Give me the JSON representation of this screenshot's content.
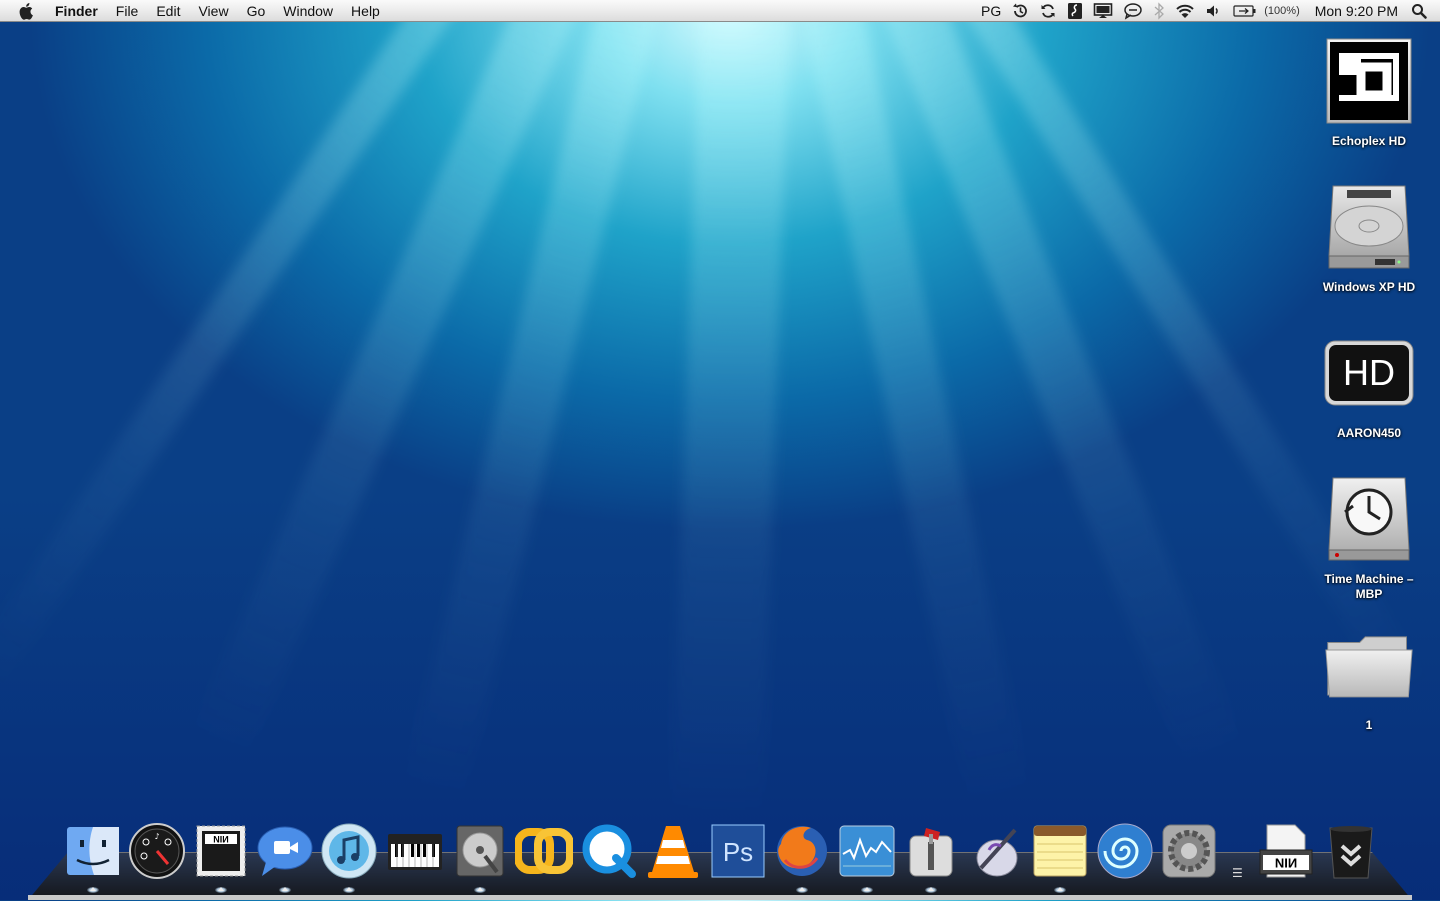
{
  "menubar": {
    "app_name": "Finder",
    "menus": [
      "File",
      "Edit",
      "View",
      "Go",
      "Window",
      "Help"
    ],
    "status": {
      "input_source": "PG",
      "battery_percent": "(100%)",
      "clock": "Mon 9:20 PM"
    },
    "icons": [
      "apple-icon",
      "time-machine-icon",
      "sync-icon",
      "script-icon",
      "display-icon",
      "chat-icon",
      "bluetooth-icon",
      "wifi-icon",
      "volume-icon",
      "battery-icon",
      "spotlight-icon"
    ]
  },
  "desktop_icons": [
    {
      "label": "Echoplex HD",
      "icon": "echoplex-drive-icon"
    },
    {
      "label": "Windows XP HD",
      "icon": "hard-drive-icon"
    },
    {
      "label": "AARON450",
      "icon": "hd-icon"
    },
    {
      "label": "Time Machine –\nMBP",
      "line1": "Time Machine –",
      "line2": "MBP",
      "icon": "time-machine-drive-icon"
    },
    {
      "label": "1",
      "icon": "folder-icon"
    }
  ],
  "dock": {
    "items": [
      {
        "name": "Finder",
        "icon": "finder-icon",
        "running": true
      },
      {
        "name": "Dashboard",
        "icon": "dashboard-icon",
        "running": false
      },
      {
        "name": "NIN",
        "icon": "nin-stamp-icon",
        "running": true
      },
      {
        "name": "iChat",
        "icon": "ichat-icon",
        "running": true
      },
      {
        "name": "iTunes",
        "icon": "itunes-icon",
        "running": true
      },
      {
        "name": "Keyboard",
        "icon": "piano-keyboard-icon",
        "running": false
      },
      {
        "name": "Disk Utility",
        "icon": "disk-utility-icon",
        "running": true
      },
      {
        "name": "Link",
        "icon": "chain-link-icon",
        "running": false
      },
      {
        "name": "QuickTime",
        "icon": "quicktime-icon",
        "running": false
      },
      {
        "name": "VLC",
        "icon": "vlc-icon",
        "running": false
      },
      {
        "name": "Photoshop",
        "icon": "photoshop-icon",
        "running": false
      },
      {
        "name": "Firefox",
        "icon": "firefox-icon",
        "running": true
      },
      {
        "name": "Activity Monitor",
        "icon": "activity-monitor-icon",
        "running": true
      },
      {
        "name": "Transmission",
        "icon": "transmission-icon",
        "running": true
      },
      {
        "name": "Script Editor",
        "icon": "script-editor-icon",
        "running": false
      },
      {
        "name": "Notes",
        "icon": "notepad-icon",
        "running": true
      },
      {
        "name": "Spiral",
        "icon": "spiral-icon",
        "running": false
      },
      {
        "name": "System Preferences",
        "icon": "system-preferences-icon",
        "running": false
      },
      {
        "name": "NIN Document",
        "icon": "nin-document-icon",
        "running": false
      },
      {
        "name": "Trash",
        "icon": "trash-icon",
        "running": false
      }
    ],
    "colors": {
      "finder": "#6fa9f2",
      "itunes": "#5fb7e8",
      "photoshop": "#1f4e99",
      "link": "#f6b51c",
      "quicktime": "#1a8fe0",
      "vlc": "#ff8a00"
    }
  }
}
